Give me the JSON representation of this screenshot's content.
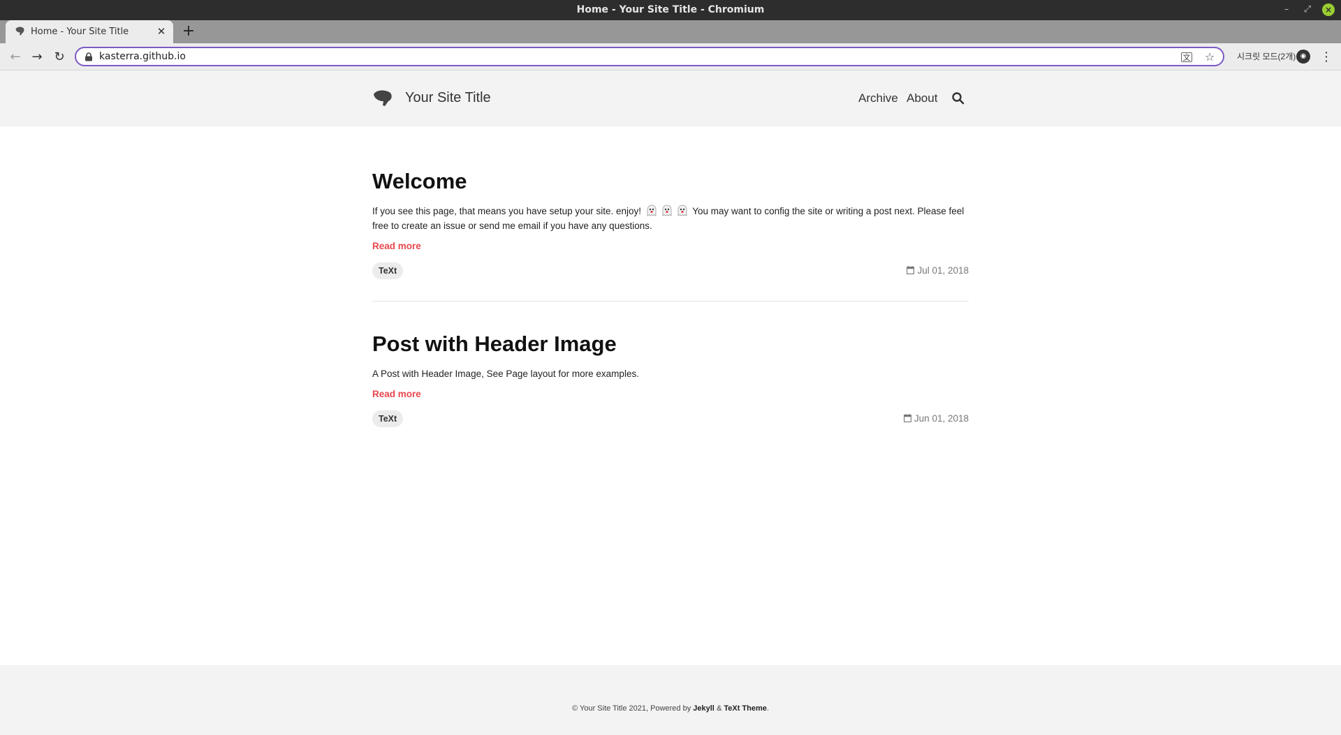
{
  "window": {
    "title": "Home - Your Site Title - Chromium"
  },
  "tab": {
    "title": "Home - Your Site Title"
  },
  "toolbar": {
    "url": "kasterra.github.io",
    "incognito_label": "시크릿 모드(2개)"
  },
  "site": {
    "title": "Your Site Title",
    "nav": {
      "archive": "Archive",
      "about": "About"
    }
  },
  "posts": [
    {
      "title": "Welcome",
      "excerpt_before": "If you see this page, that means you have setup your site. enjoy!",
      "excerpt_after": "You may want to config the site or writing a post next. Please feel free to create an issue or send me email if you have any questions.",
      "read_more": "Read more",
      "tag": "TeXt",
      "date": "Jul 01, 2018"
    },
    {
      "title": "Post with Header Image",
      "excerpt": "A Post with Header Image, See Page layout for more examples.",
      "read_more": "Read more",
      "tag": "TeXt",
      "date": "Jun 01, 2018"
    }
  ],
  "footer": {
    "prefix": "© Your Site Title 2021, Powered by",
    "jekyll": "Jekyll",
    "amp": "&",
    "theme": "TeXt Theme",
    "suffix": "."
  },
  "icons": {
    "tab_favicon": "ginkgo-leaf-icon",
    "site_logo": "ginkgo-leaf-icon",
    "search": "search-icon",
    "calendar": "calendar-icon",
    "emoji": "ghost-icon"
  },
  "colors": {
    "accent": "#e8474e",
    "omnibox_border": "#7b59c4",
    "header_bg": "#f3f3f3"
  }
}
